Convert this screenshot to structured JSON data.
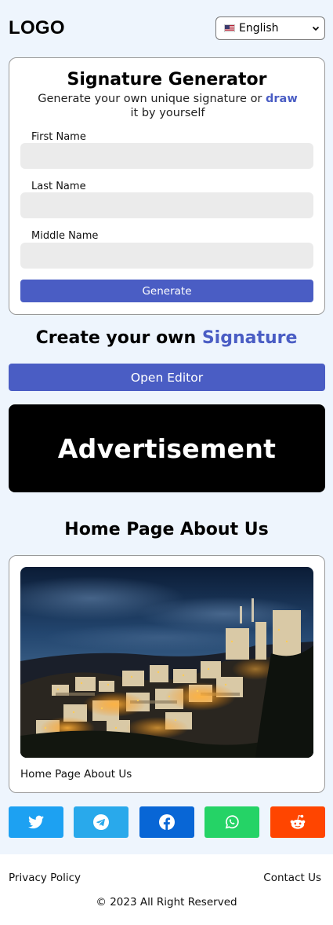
{
  "header": {
    "logo": "LOGO",
    "language": {
      "selected": "English",
      "flag_icon": "us-flag-icon"
    }
  },
  "generator": {
    "title": "Signature Generator",
    "subtitle_before": "Generate your own unique signature or ",
    "subtitle_link": "draw",
    "subtitle_after": " it by yourself",
    "fields": [
      {
        "label": "First Name",
        "value": ""
      },
      {
        "label": "Last Name",
        "value": ""
      },
      {
        "label": "Middle Name",
        "value": ""
      }
    ],
    "generate_label": "Generate"
  },
  "create": {
    "heading_before": "Create your own ",
    "heading_accent": "Signature",
    "open_editor_label": "Open Editor"
  },
  "ad": {
    "label": "Advertisement"
  },
  "about": {
    "heading": "Home Page About Us",
    "caption": "Home Page About Us"
  },
  "social": [
    {
      "name": "twitter-icon",
      "color": "#1da1f2"
    },
    {
      "name": "telegram-icon",
      "color": "#29a9eb"
    },
    {
      "name": "facebook-icon",
      "color": "#0866d6"
    },
    {
      "name": "whatsapp-icon",
      "color": "#25d366"
    },
    {
      "name": "reddit-icon",
      "color": "#ff4500"
    }
  ],
  "footer": {
    "privacy": "Privacy Policy",
    "contact": "Contact Us",
    "copyright": "© 2023 All Right Reserved"
  },
  "colors": {
    "accent": "#4a5dc4",
    "page_bg": "#eef5fd"
  }
}
